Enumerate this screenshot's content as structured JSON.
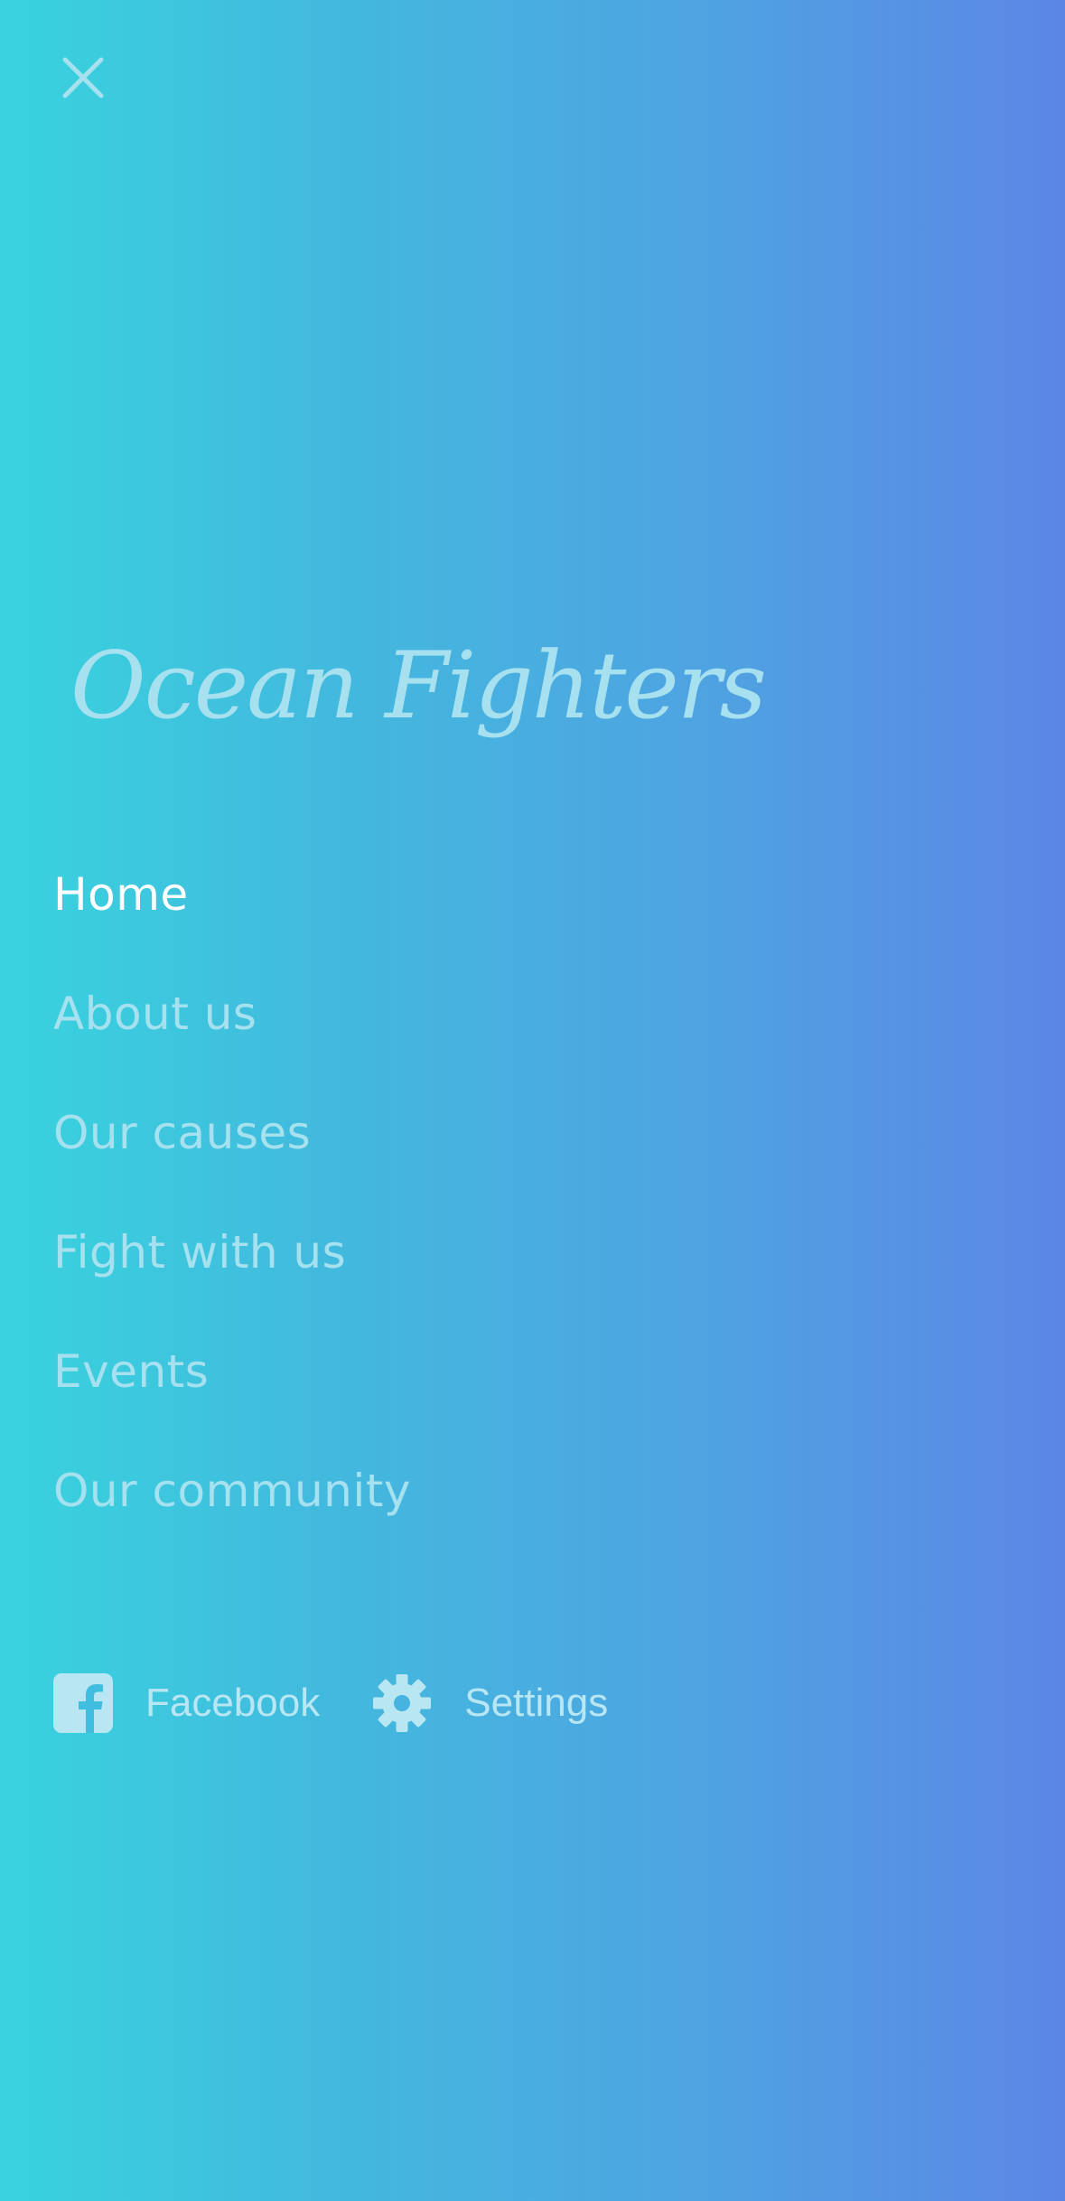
{
  "brand": {
    "logo_text": "Ocean Fighters"
  },
  "header": {
    "close_icon": "close-icon"
  },
  "nav": {
    "items": [
      {
        "label": "Home",
        "active": true
      },
      {
        "label": "About us",
        "active": false
      },
      {
        "label": "Our causes",
        "active": false
      },
      {
        "label": "Fight with us",
        "active": false
      },
      {
        "label": "Events",
        "active": false
      },
      {
        "label": "Our community",
        "active": false
      }
    ]
  },
  "footer_links": [
    {
      "label": "Facebook",
      "icon": "facebook-icon"
    },
    {
      "label": "Settings",
      "icon": "gear-icon"
    }
  ],
  "colors": {
    "gradient_start": "#38d3de",
    "gradient_end": "#5c86e6",
    "text_muted": "#a5e1ef",
    "text_active": "#ffffff"
  }
}
